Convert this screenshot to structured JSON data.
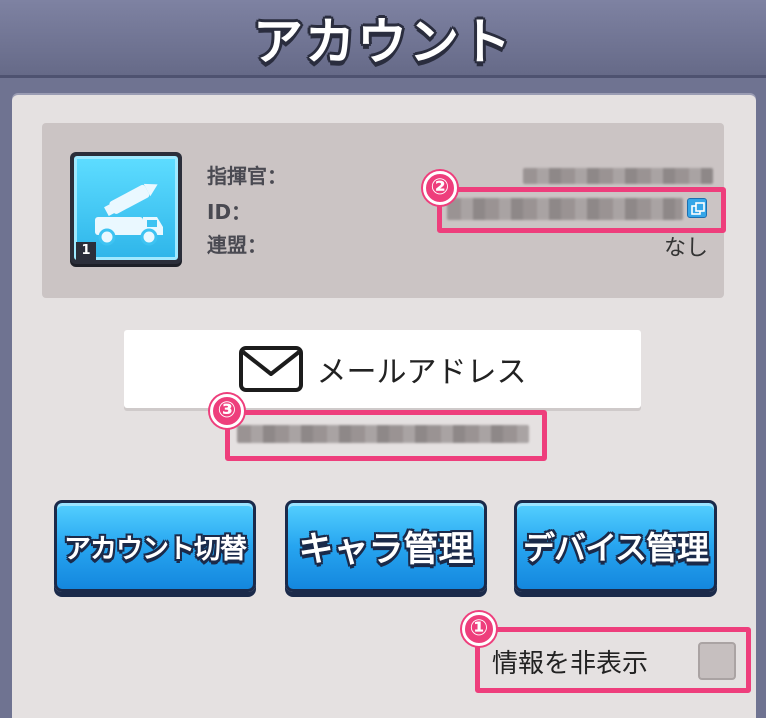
{
  "header": {
    "title": "アカウント"
  },
  "profile": {
    "level": "1",
    "labels": {
      "commander": "指揮官：",
      "id": "ID：",
      "alliance": "連盟："
    },
    "alliance_value": "なし",
    "avatar_icon": "rocket-truck-icon",
    "copy_icon": "copy-icon"
  },
  "email": {
    "label": "メールアドレス",
    "icon": "envelope-icon"
  },
  "buttons": {
    "switch_account": "アカウント切替",
    "character_manage": "キャラ管理",
    "device_manage": "デバイス管理"
  },
  "hide_info": {
    "label": "情報を非表示",
    "checked": false
  },
  "annotations": [
    "①",
    "②",
    "③"
  ],
  "colors": {
    "accent": "#ee3e7c",
    "button": "#27a5f0",
    "header": "#6f7391"
  }
}
